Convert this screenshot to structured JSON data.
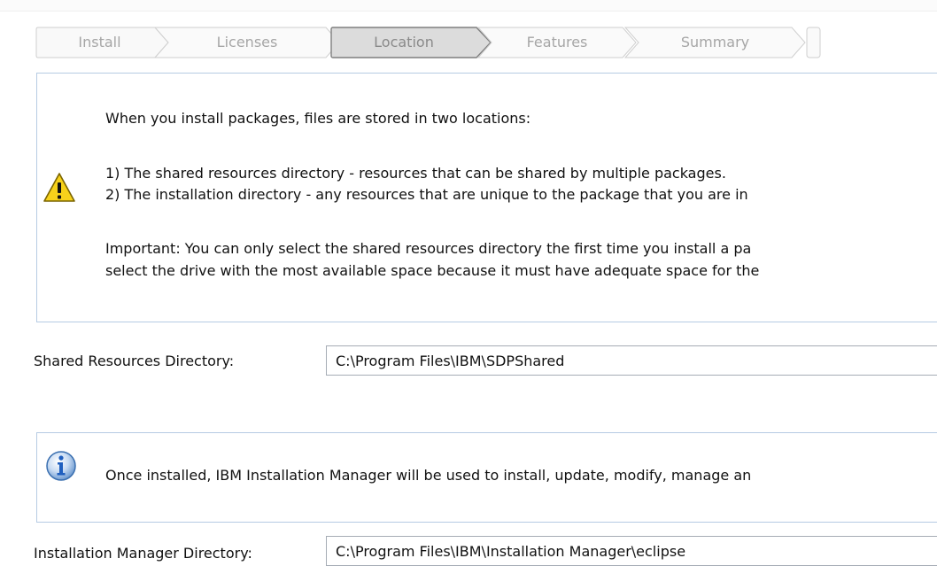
{
  "wizard": {
    "steps": [
      {
        "label": "Install",
        "state": "inactive"
      },
      {
        "label": "Licenses",
        "state": "inactive"
      },
      {
        "label": "Location",
        "state": "active"
      },
      {
        "label": "Features",
        "state": "inactive"
      },
      {
        "label": "Summary",
        "state": "inactive"
      }
    ]
  },
  "warning": {
    "icon": "warning-icon",
    "line1": "When you install packages, files are stored in two locations:",
    "line2": "1) The shared resources directory - resources that can be shared by multiple packages.",
    "line3": "2) The installation directory - any resources that are unique to the package that you are in",
    "line4": "Important: You can only select the shared resources directory the first time you install a pa",
    "line5": "select the drive with the most available space because it must have adequate space for the"
  },
  "shared_resources": {
    "label": "Shared Resources Directory:",
    "value": "C:\\Program Files\\IBM\\SDPShared"
  },
  "info": {
    "icon": "info-icon",
    "text": "Once installed, IBM Installation Manager will be used to install, update, modify, manage an"
  },
  "installation_manager": {
    "label": "Installation Manager Directory:",
    "value": "C:\\Program Files\\IBM\\Installation Manager\\eclipse"
  },
  "colors": {
    "box_border": "#b6cbe3",
    "step_text": "#a6a6a6",
    "active_step_fill": "#dcdcdc",
    "warning_yellow": "#f7d21b",
    "info_blue": "#2f6fbf"
  }
}
